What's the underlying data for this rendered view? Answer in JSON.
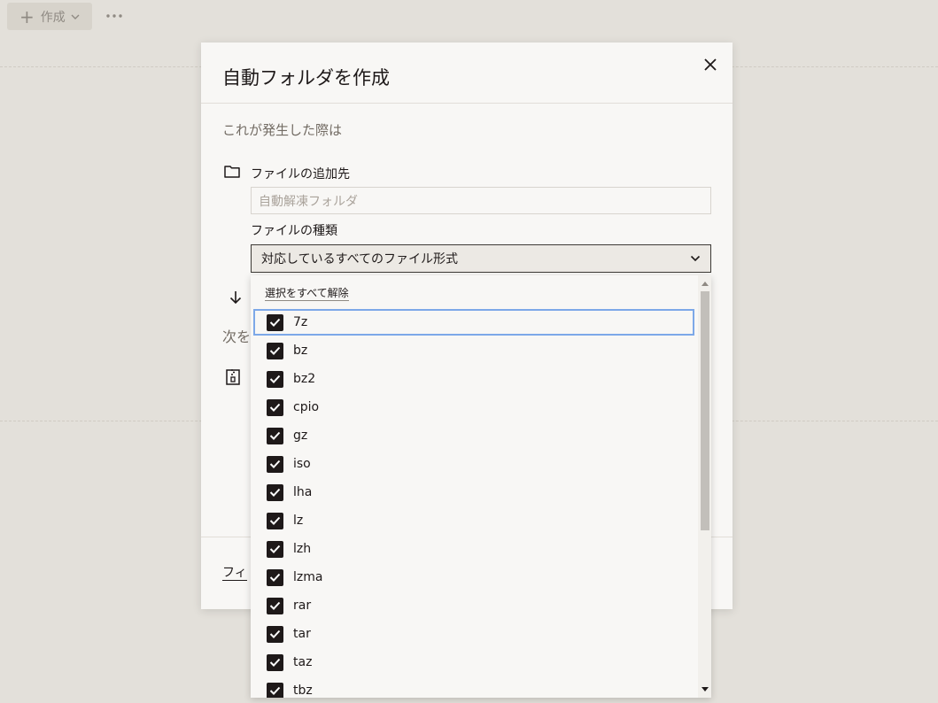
{
  "toolbar": {
    "create_label": "作成",
    "plus_icon": "plus-icon",
    "more_icon": "more-horizontal-icon"
  },
  "modal": {
    "title": "自動フォルダを作成",
    "when_label": "これが発生した際は",
    "destination_label": "ファイルの追加先",
    "destination_placeholder": "自動解凍フォルダ",
    "file_type_label": "ファイルの種類",
    "file_type_selected": "対応しているすべてのファイル形式",
    "next_label": "次を",
    "footer_link": "フィ"
  },
  "dropdown": {
    "deselect_all": "選択をすべて解除",
    "options": [
      "7z",
      "bz",
      "bz2",
      "cpio",
      "gz",
      "iso",
      "lha",
      "lz",
      "lzh",
      "lzma",
      "rar",
      "tar",
      "taz",
      "tbz"
    ],
    "checked": true,
    "focused_option": "7z"
  },
  "colors": {
    "background": "#e3e0da",
    "modal_bg": "#f8f7f5",
    "checkbox": "#1e1919",
    "focus_ring": "#7da8e8"
  }
}
